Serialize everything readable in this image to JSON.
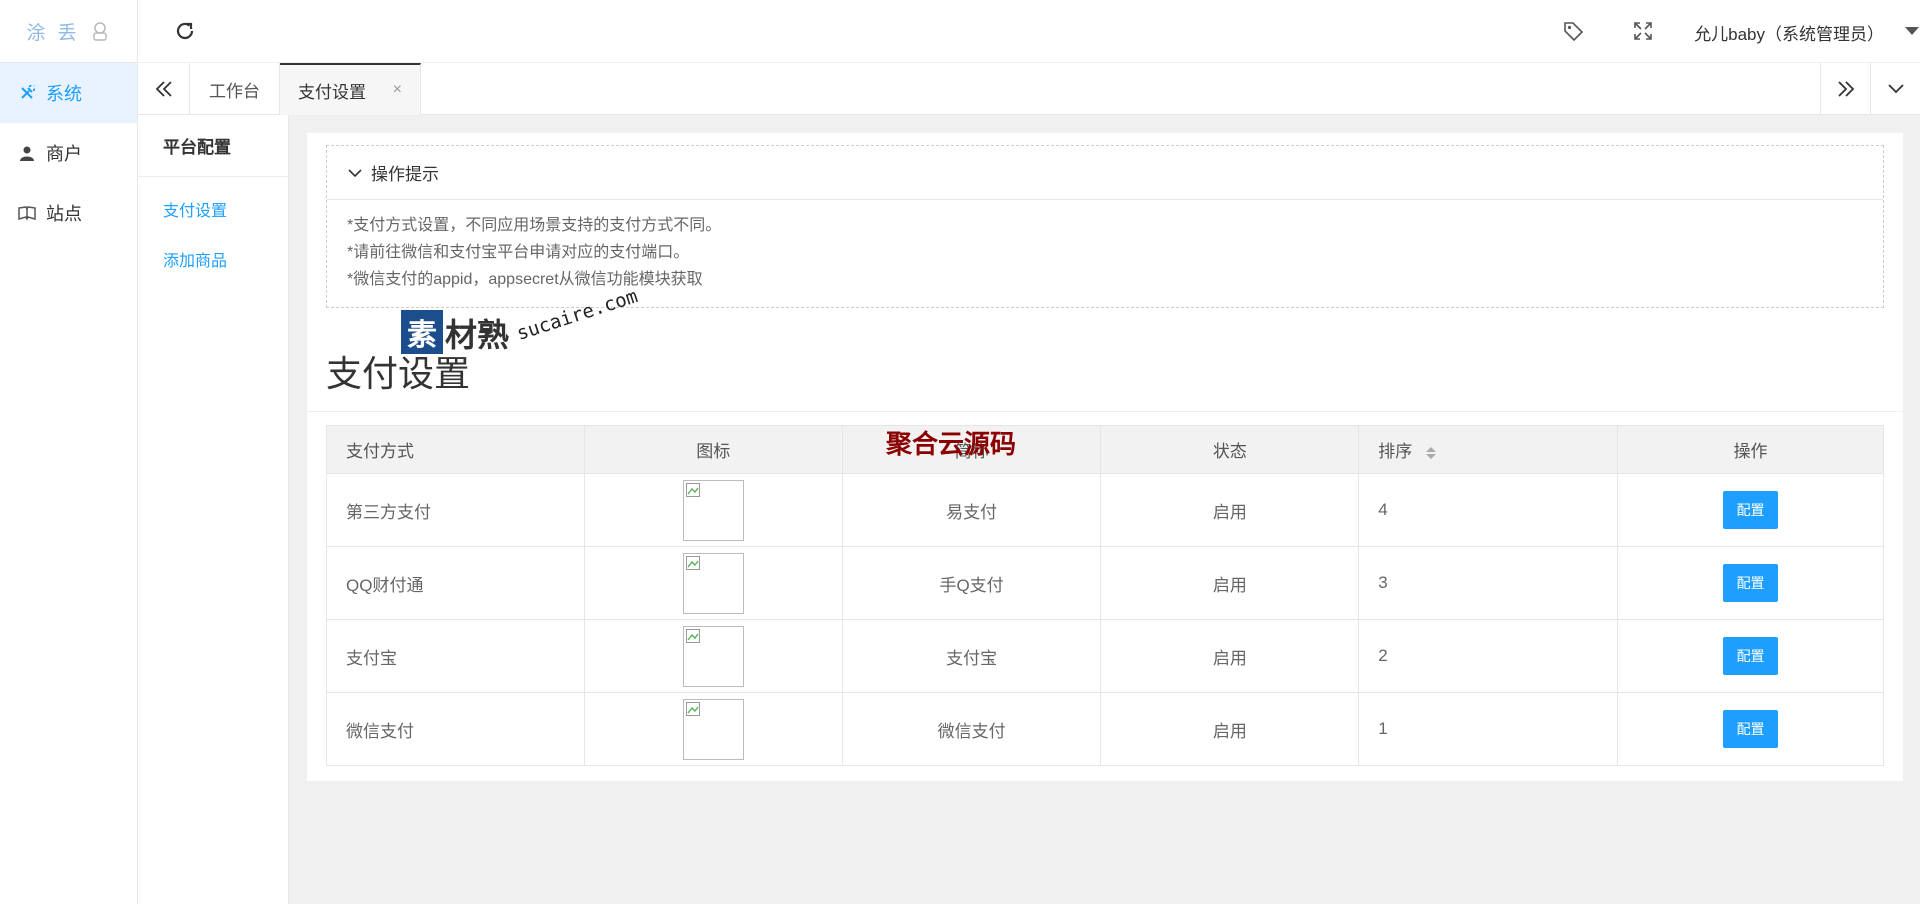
{
  "brand": {
    "logo_text_1": "涂",
    "logo_text_2": "丢"
  },
  "sidebar": {
    "items": [
      {
        "label": "系统",
        "icon": "tools-icon",
        "active": true
      },
      {
        "label": "商户",
        "icon": "user-icon",
        "active": false
      },
      {
        "label": "站点",
        "icon": "book-icon",
        "active": false
      }
    ]
  },
  "header": {
    "user": "允儿baby（系统管理员）"
  },
  "tabs": {
    "home": "工作台",
    "current": "支付设置",
    "close": "×"
  },
  "subnav": {
    "title": "平台配置",
    "links": [
      "支付设置",
      "添加商品"
    ]
  },
  "tips": {
    "title": "操作提示",
    "lines": [
      "*支付方式设置，不同应用场景支持的支付方式不同。",
      "*请前往微信和支付宝平台申请对应的支付端口。",
      "*微信支付的appid，appsecret从微信功能模块获取"
    ]
  },
  "page": {
    "title": "支付设置"
  },
  "table": {
    "headers": [
      "支付方式",
      "图标",
      "简称",
      "状态",
      "排序",
      "操作"
    ],
    "rows": [
      {
        "method": "第三方支付",
        "short": "易支付",
        "status": "启用",
        "sort": "4",
        "action": "配置"
      },
      {
        "method": "QQ财付通",
        "short": "手Q支付",
        "status": "启用",
        "sort": "3",
        "action": "配置"
      },
      {
        "method": "支付宝",
        "short": "支付宝",
        "status": "启用",
        "sort": "2",
        "action": "配置"
      },
      {
        "method": "微信支付",
        "short": "微信支付",
        "status": "启用",
        "sort": "1",
        "action": "配置"
      }
    ]
  },
  "watermarks": {
    "sucai_a": "素",
    "sucai_b": "材熟",
    "sucai_domain": "sucaire.com",
    "juhe": "聚合云源码"
  },
  "colors": {
    "accent": "#1e9fff",
    "active_bg": "#e8f3ff"
  }
}
